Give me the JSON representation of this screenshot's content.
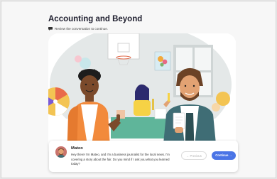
{
  "page": {
    "title": "Accounting and Beyond",
    "subtitle": "Review the conversation to continue."
  },
  "dialog": {
    "speaker": "Mateo",
    "message": "Hey there! I'm Mateo, and I'm a business journalist for the local news. I'm covering a story about the fair. Do you mind if I ask you what you learned today?",
    "previous_label": "← Previous",
    "continue_label": "Continue →"
  },
  "icons": {
    "subtitle_icon": "chat-bubble-icon",
    "avatar": "avatar-mateo"
  },
  "colors": {
    "accent": "#4a74e6",
    "page_bg": "#f7f7f7",
    "title": "#1e1e2e"
  }
}
